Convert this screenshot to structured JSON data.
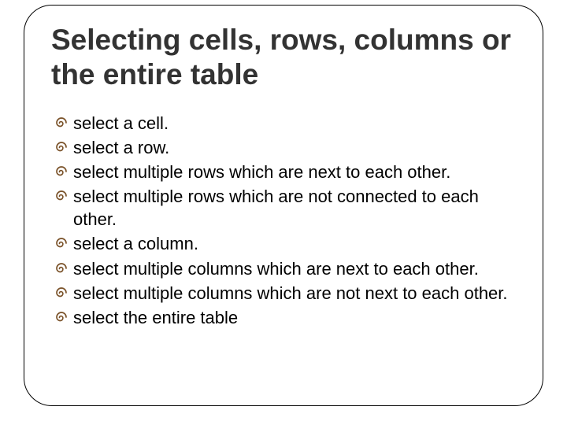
{
  "title": "Selecting cells, rows, columns or the entire table",
  "items": [
    "select a cell.",
    "select a row.",
    "select multiple rows which are next to each other.",
    "select multiple rows which are not connected to each other.",
    "select a column.",
    "select multiple columns which are next to each other.",
    "select multiple columns which are not next to each other.",
    "select the entire table"
  ]
}
